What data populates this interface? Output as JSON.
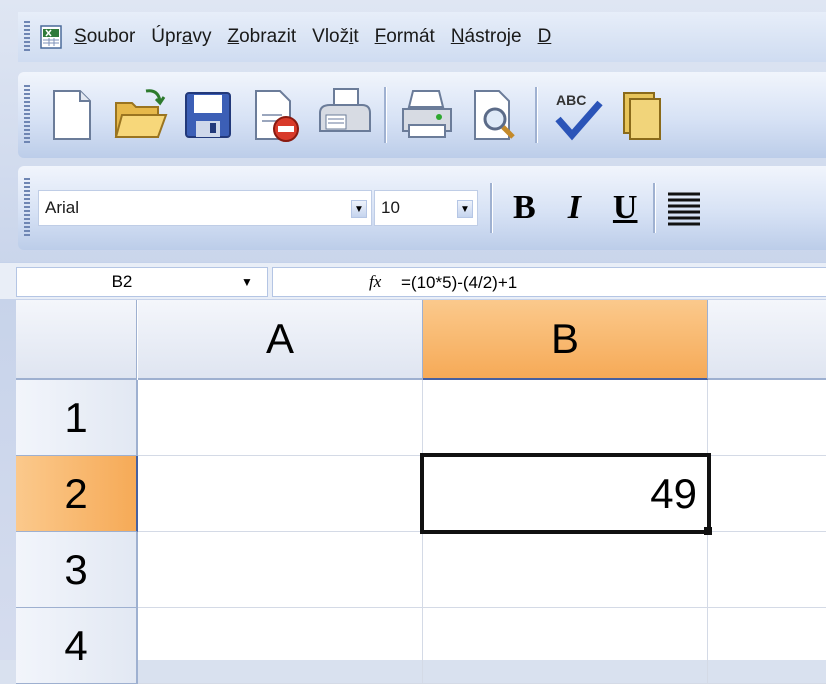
{
  "menubar": {
    "items": [
      {
        "pre": "",
        "ul": "S",
        "post": "oubor"
      },
      {
        "pre": "Úpr",
        "ul": "a",
        "post": "vy"
      },
      {
        "pre": "",
        "ul": "Z",
        "post": "obrazit"
      },
      {
        "pre": "Vlož",
        "ul": "i",
        "post": "t"
      },
      {
        "pre": "",
        "ul": "F",
        "post": "ormát"
      },
      {
        "pre": "",
        "ul": "N",
        "post": "ástroje"
      },
      {
        "pre": "",
        "ul": "D",
        "post": ""
      }
    ]
  },
  "toolbar": {
    "buttons": [
      "new-document",
      "open-folder",
      "save-disk",
      "permission",
      "print-fax",
      "print",
      "print-preview",
      "spelling",
      "research"
    ]
  },
  "format": {
    "font": "Arial",
    "size": "10",
    "bold": "B",
    "italic": "I",
    "underline": "U"
  },
  "formula_bar": {
    "name_box": "B2",
    "fx_label": "fx",
    "formula": "=(10*5)-(4/2)+1"
  },
  "sheet": {
    "columns": [
      "A",
      "B"
    ],
    "rows": [
      "1",
      "2",
      "3",
      "4"
    ],
    "active_cell": "B2",
    "active_value": "49"
  },
  "colors": {
    "selected_header": "#f6aa57",
    "toolbar": "#d7e2f5"
  }
}
